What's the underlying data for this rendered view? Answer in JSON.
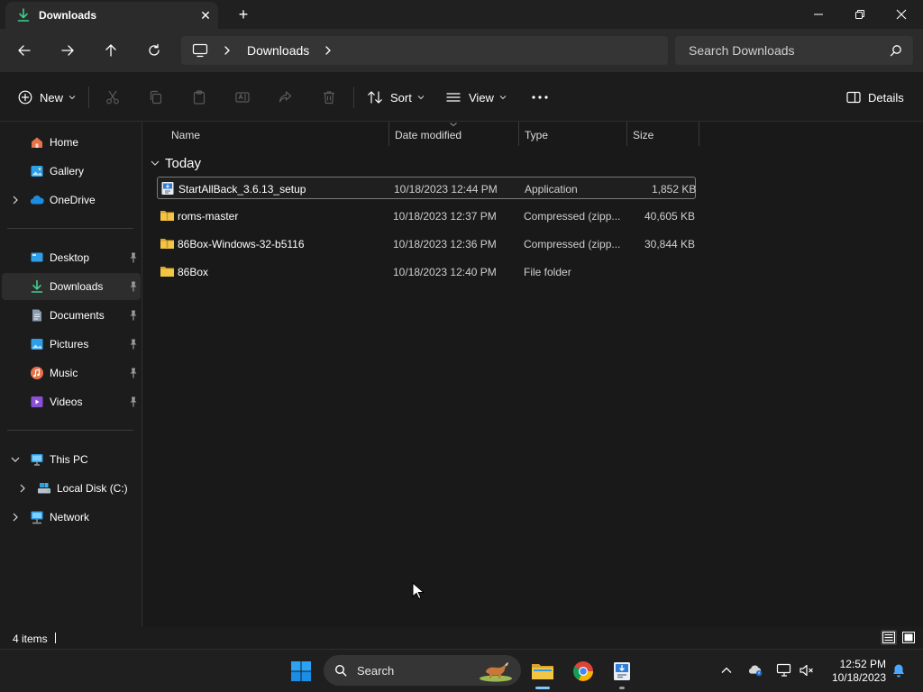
{
  "window": {
    "tab_title": "Downloads",
    "tab_close_glyph": "✕",
    "new_tab_glyph": "+"
  },
  "navbar": {
    "breadcrumb": "Downloads",
    "search_placeholder": "Search Downloads"
  },
  "commandbar": {
    "new_label": "New",
    "sort_label": "Sort",
    "view_label": "View",
    "details_label": "Details"
  },
  "sidebar": {
    "quick": [
      {
        "label": "Home",
        "icon": "home-icon"
      },
      {
        "label": "Gallery",
        "icon": "gallery-icon"
      },
      {
        "label": "OneDrive",
        "icon": "onedrive-icon"
      }
    ],
    "pinned": [
      {
        "label": "Desktop",
        "icon": "desktop-icon"
      },
      {
        "label": "Downloads",
        "icon": "downloads-icon",
        "active": true
      },
      {
        "label": "Documents",
        "icon": "documents-icon"
      },
      {
        "label": "Pictures",
        "icon": "pictures-icon"
      },
      {
        "label": "Music",
        "icon": "music-icon"
      },
      {
        "label": "Videos",
        "icon": "videos-icon"
      }
    ],
    "devices": [
      {
        "label": "This PC",
        "icon": "this-pc-icon"
      },
      {
        "label": "Local Disk (C:)",
        "icon": "local-disk-icon"
      },
      {
        "label": "Network",
        "icon": "network-icon"
      }
    ]
  },
  "filelist": {
    "columns": {
      "name": "Name",
      "date": "Date modified",
      "type": "Type",
      "size": "Size"
    },
    "group_label": "Today",
    "rows": [
      {
        "name": "StartAllBack_3.6.13_setup",
        "date": "10/18/2023 12:44 PM",
        "type": "Application",
        "size": "1,852 KB",
        "icon": "installer-icon"
      },
      {
        "name": "roms-master",
        "date": "10/18/2023 12:37 PM",
        "type": "Compressed (zipp...",
        "size": "40,605 KB",
        "icon": "zip-folder-icon"
      },
      {
        "name": "86Box-Windows-32-b5116",
        "date": "10/18/2023 12:36 PM",
        "type": "Compressed (zipp...",
        "size": "30,844 KB",
        "icon": "zip-folder-icon"
      },
      {
        "name": "86Box",
        "date": "10/18/2023 12:40 PM",
        "type": "File folder",
        "size": "",
        "icon": "folder-icon"
      }
    ]
  },
  "status": {
    "item_count": "4 items"
  },
  "taskbar": {
    "search_label": "Search",
    "time": "12:52 PM",
    "date": "10/18/2023"
  },
  "colors": {
    "accent": "#7fc8ff",
    "folder": "#f4c542",
    "background": "#191919"
  }
}
